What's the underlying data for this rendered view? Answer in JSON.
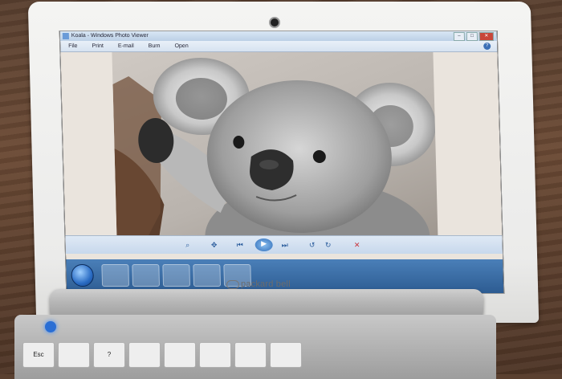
{
  "window": {
    "title": "Koala - Windows Photo Viewer"
  },
  "menu": {
    "items": [
      "File",
      "Print",
      "E-mail",
      "Burn",
      "Open"
    ],
    "help": "?"
  },
  "brand": {
    "name": "packard bell"
  },
  "keyboard": {
    "esc": "Esc",
    "key2": "?"
  },
  "colors": {
    "taskbar": "#2d5c92",
    "menubar": "#d6e2f0",
    "power_led": "#2a6ed4"
  }
}
